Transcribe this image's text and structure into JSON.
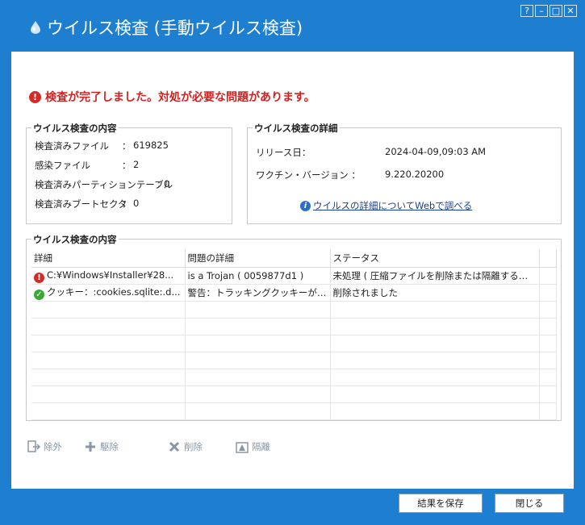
{
  "window": {
    "title": "ウイルス検査 (手動ウイルス検査)",
    "controls": {
      "help": "?",
      "minimize": "–",
      "maximize": "□",
      "close": "✕"
    }
  },
  "alert": {
    "icon": "error-icon",
    "text": "検査が完了しました。対処が必要な問題があります。"
  },
  "summary": {
    "title": "ウイルス検査の内容",
    "items": [
      {
        "label": "検査済みファイル",
        "sep": "：",
        "value": "619825"
      },
      {
        "label": "感染ファイル",
        "sep": "：",
        "value": "2"
      },
      {
        "label": "検査済みパーティションテーブル",
        "sep": ":",
        "value": "0"
      },
      {
        "label": "検査済みブートセクタ",
        "sep": "：",
        "value": "0"
      }
    ]
  },
  "details": {
    "title": "ウイルス検査の詳細",
    "release_label": "リリース日：",
    "release_value": "2024-04-09,09:03 AM",
    "vaccine_label": "ワクチン・バージョン ：",
    "vaccine_value": "9.220.20200",
    "link": "ウイルスの詳細についてWebで調べる"
  },
  "results": {
    "title": "ウイルス検査の内容",
    "columns": [
      "詳細",
      "問題の詳細",
      "ステータス"
    ],
    "rows": [
      {
        "status_icon": "error-icon",
        "detail": "C:¥Windows¥Installer¥28...",
        "problem": "is a Trojan ( 0059877d1 )",
        "status": "未処理 ( 圧縮ファイルを削除または隔離する必要..."
      },
      {
        "status_icon": "check-icon",
        "detail": "クッキー：:cookies.sqlite:.d...",
        "problem": "警告：トラッキングクッキーが見つ...",
        "status": "削除されました"
      }
    ]
  },
  "actions": {
    "exclude": "除外",
    "disinfect": "駆除",
    "delete": "削除",
    "quarantine": "隔離"
  },
  "buttons": {
    "save": "結果を保存",
    "close": "閉じる"
  },
  "colors": {
    "frame": "#1e7fd0",
    "alert": "#d42020",
    "link": "#1a3f8a"
  }
}
